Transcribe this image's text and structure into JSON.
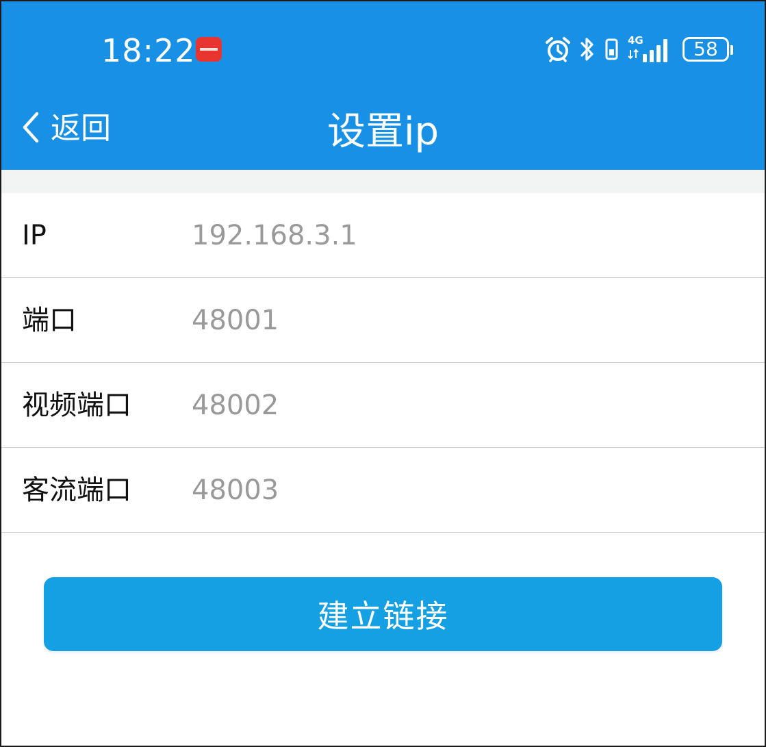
{
  "status_bar": {
    "time": "18:22",
    "network_label": "4G",
    "battery": "58",
    "icons": [
      "app-notification-icon",
      "alarm-icon",
      "bluetooth-icon",
      "vibrate-icon",
      "signal-icon",
      "battery-icon"
    ]
  },
  "nav": {
    "back_label": "返回",
    "title": "设置ip"
  },
  "form": {
    "ip": {
      "label": "IP",
      "value": "192.168.3.1"
    },
    "port": {
      "label": "端口",
      "value": "48001"
    },
    "video_port": {
      "label": "视频端口",
      "value": "48002"
    },
    "traffic_port": {
      "label": "客流端口",
      "value": "48003"
    }
  },
  "actions": {
    "connect_label": "建立链接"
  },
  "colors": {
    "header": "#1790e6",
    "button": "#14a0e3",
    "value_text": "#999999"
  }
}
